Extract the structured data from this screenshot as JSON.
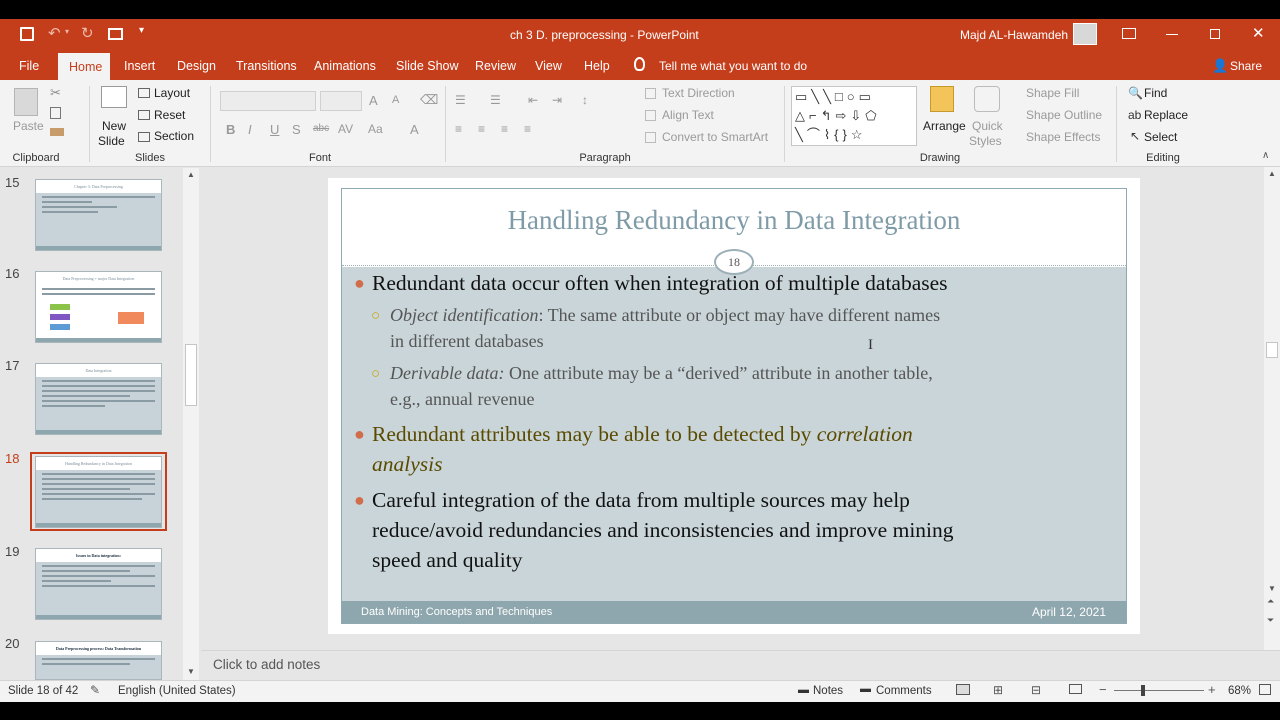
{
  "window": {
    "doc_title": "ch 3 D. preprocessing  -  PowerPoint",
    "user_name": "Majd AL-Hawamdeh"
  },
  "tabs": [
    "File",
    "Home",
    "Insert",
    "Design",
    "Transitions",
    "Animations",
    "Slide Show",
    "Review",
    "View",
    "Help"
  ],
  "tell_me": "Tell me what you want to do",
  "share_label": "Share",
  "ribbon": {
    "clipboard": {
      "paste": "Paste",
      "label": "Clipboard"
    },
    "slides": {
      "new_slide_1": "New",
      "new_slide_2": "Slide",
      "layout": "Layout",
      "reset": "Reset",
      "section": "Section",
      "label": "Slides"
    },
    "font": {
      "label": "Font"
    },
    "paragraph": {
      "text_direction": "Text Direction",
      "align_text": "Align Text",
      "convert_smartart": "Convert to SmartArt",
      "label": "Paragraph"
    },
    "drawing": {
      "arrange": "Arrange",
      "quick_styles_1": "Quick",
      "quick_styles_2": "Styles",
      "shape_fill": "Shape Fill",
      "shape_outline": "Shape Outline",
      "shape_effects": "Shape Effects",
      "label": "Drawing"
    },
    "editing": {
      "find": "Find",
      "replace": "Replace",
      "select": "Select",
      "label": "Editing"
    }
  },
  "thumbnails": [
    {
      "num": "15",
      "title": "Chapter 3: Data Preprocessing"
    },
    {
      "num": "16",
      "title": "Data Preprocessing + major Data Integration"
    },
    {
      "num": "17",
      "title": "Data Integration"
    },
    {
      "num": "18",
      "title": "Handling Redundancy in Data Integration"
    },
    {
      "num": "19",
      "title": "Issues in Data integration:"
    },
    {
      "num": "20",
      "title": "Data Preprocessing process: Data Transformation"
    }
  ],
  "slide": {
    "title": "Handling Redundancy in Data Integration",
    "number": "18",
    "bullets": [
      "Redundant data occur often when integration of multiple databases",
      "Redundant attributes may be able to be detected by ",
      "Careful integration of the data from multiple sources may help",
      "reduce/avoid redundancies and inconsistencies and improve mining",
      "speed and quality"
    ],
    "correlation_1": "correlation",
    "correlation_2": "analysis",
    "sub1_italic": "Object identification",
    "sub1_rest": ":  The same attribute or object may have different names",
    "sub1_line2": "in different databases",
    "sub2_italic": "Derivable data:",
    "sub2_rest": " One attribute may be a “derived” attribute in another table,",
    "sub2_line2": "e.g., annual revenue",
    "footer_left": "Data Mining: Concepts and Techniques",
    "footer_right": "April 12, 2021"
  },
  "notes_placeholder": "Click to add notes",
  "status": {
    "slide_info": "Slide 18 of 42",
    "language": "English (United States)",
    "notes": "Notes",
    "comments": "Comments",
    "zoom": "68%"
  }
}
